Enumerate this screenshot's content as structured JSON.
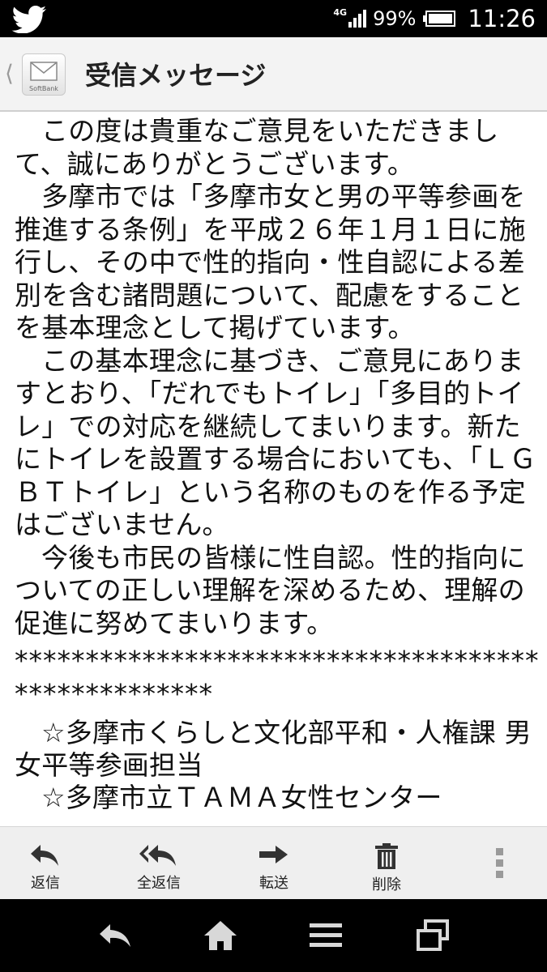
{
  "status_bar": {
    "network": "4G",
    "battery_percent": "99%",
    "time": "11:26",
    "icons": [
      "twitter-bird-icon",
      "signal-icon",
      "battery-icon"
    ]
  },
  "header": {
    "title": "受信メッセージ",
    "app_icon_brand": "SoftBank"
  },
  "message": {
    "paragraphs": [
      "この度は貴重なご意見をいただきまして、誠にありがとうございます。",
      "多摩市では「多摩市女と男の平等参画を推進する条例」を平成２６年１月１日に施行し、その中で性的指向・性自認による差別を含む諸問題について、配慮をすることを基本理念として掲げています。",
      "この基本理念に基づき、ご意見にありますとおり、「だれでもトイレ」「多目的トイレ」での対応を継続してまいります。新たにトイレを設置する場合においても、「ＬＧＢＴトイレ」という名称のものを作る予定はございません。",
      "今後も市民の皆様に性自認。性的指向についての正しい理解を深めるため、理解の促進に努めてまいります。"
    ],
    "separator_line1": "*************************************",
    "separator_line2": "**************",
    "contact_1": "☆多摩市くらしと文化部平和・人権課 男女平等参画担当",
    "contact_2": "☆多摩市立ＴＡＭＡ女性センター"
  },
  "actions": [
    {
      "label": "返信",
      "icon": "reply-icon"
    },
    {
      "label": "全返信",
      "icon": "reply-all-icon"
    },
    {
      "label": "転送",
      "icon": "forward-icon"
    },
    {
      "label": "削除",
      "icon": "trash-icon"
    }
  ],
  "nav": [
    "back-icon",
    "home-icon",
    "menu-icon",
    "recent-apps-icon"
  ]
}
